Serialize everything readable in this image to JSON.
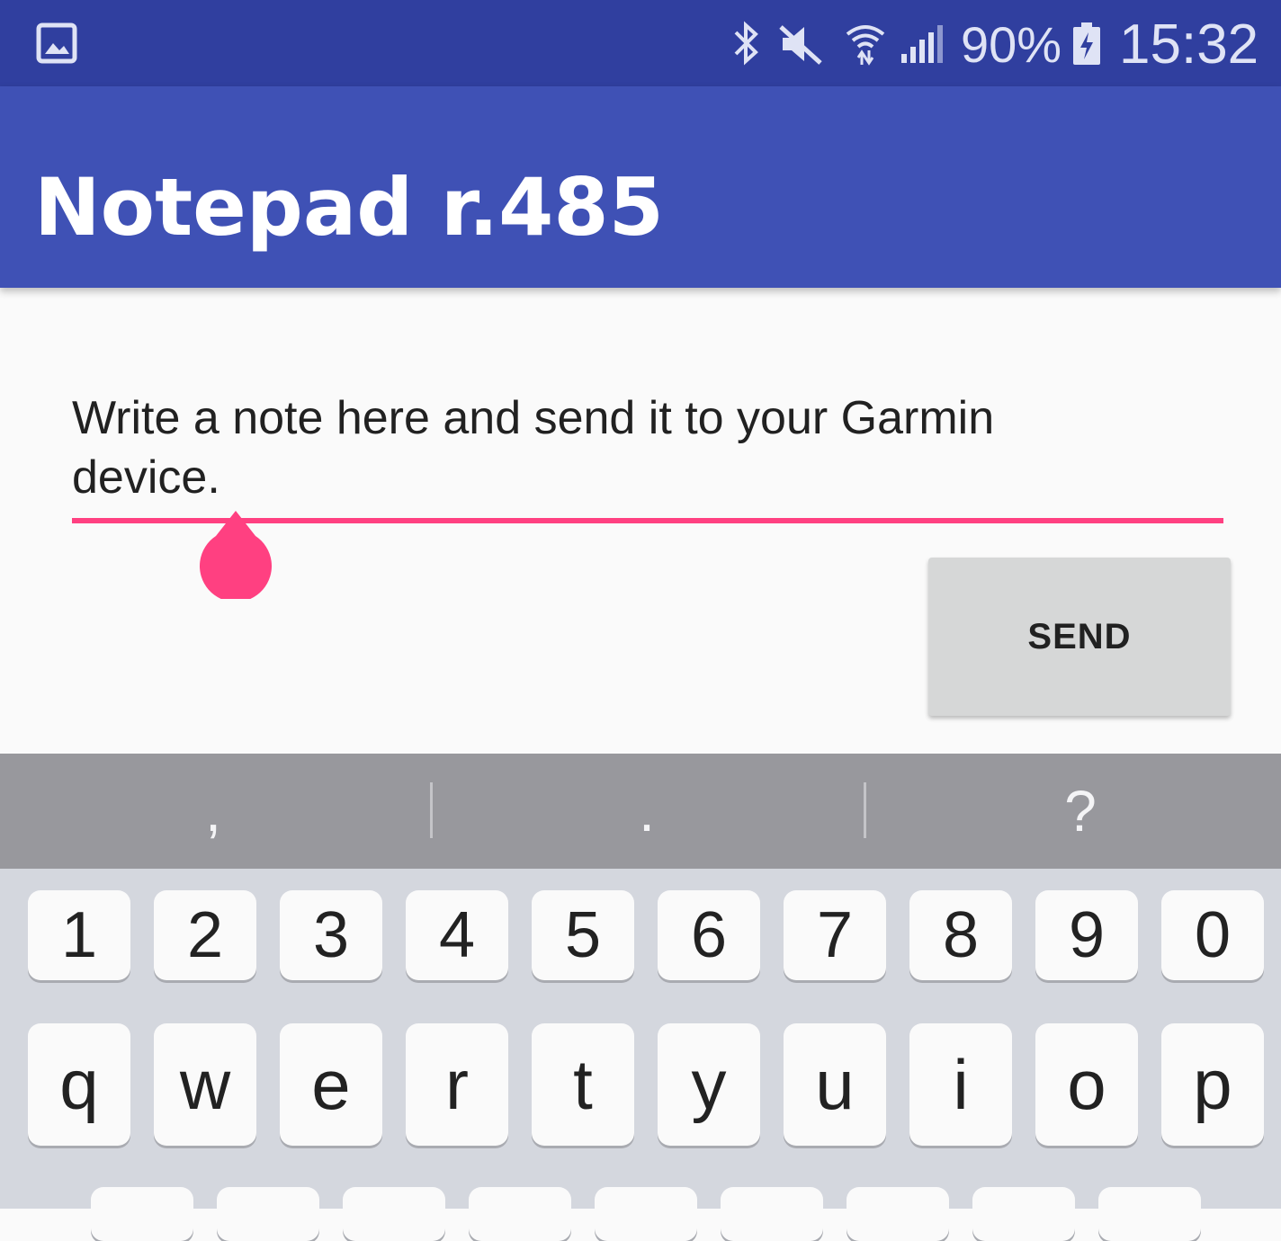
{
  "status_bar": {
    "battery_percent": "90%",
    "time": "15:32",
    "icons": [
      "gallery-icon",
      "bluetooth-icon",
      "mute-icon",
      "wifi-icon",
      "signal-icon",
      "battery-charging-icon"
    ]
  },
  "app_bar": {
    "title": "Notepad r.485"
  },
  "note": {
    "text": "Write a note here and send it to your Garmin device."
  },
  "send_button": {
    "label": "SEND"
  },
  "suggestions": [
    ",",
    ".",
    "?"
  ],
  "keyboard": {
    "number_row": [
      "1",
      "2",
      "3",
      "4",
      "5",
      "6",
      "7",
      "8",
      "9",
      "0"
    ],
    "top_row": [
      "q",
      "w",
      "e",
      "r",
      "t",
      "y",
      "u",
      "i",
      "o",
      "p"
    ]
  },
  "colors": {
    "status_bar": "#303f9f",
    "app_bar": "#3f51b5",
    "accent": "#ff4081",
    "suggestion_strip": "#98989d",
    "keyboard_bg": "#d4d7de"
  }
}
